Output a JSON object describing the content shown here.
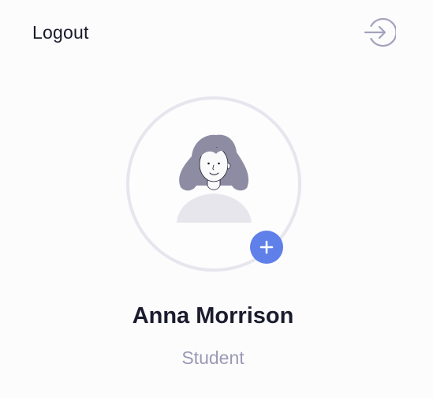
{
  "header": {
    "logout_label": "Logout",
    "logout_icon": "logout-arrow-icon"
  },
  "profile": {
    "avatar_icon": "user-avatar-illustration",
    "add_photo_icon": "plus-icon",
    "name": "Anna Morrison",
    "role": "Student"
  },
  "colors": {
    "background": "#fcfcfd",
    "text_primary": "#1b1b2e",
    "text_secondary": "#9a99b4",
    "accent": "#5f7fe9",
    "ring": "#e6e6ee",
    "hair": "#8e8ca2",
    "shirt": "#e6e6ec",
    "icon_stroke": "#a3a2bc"
  }
}
